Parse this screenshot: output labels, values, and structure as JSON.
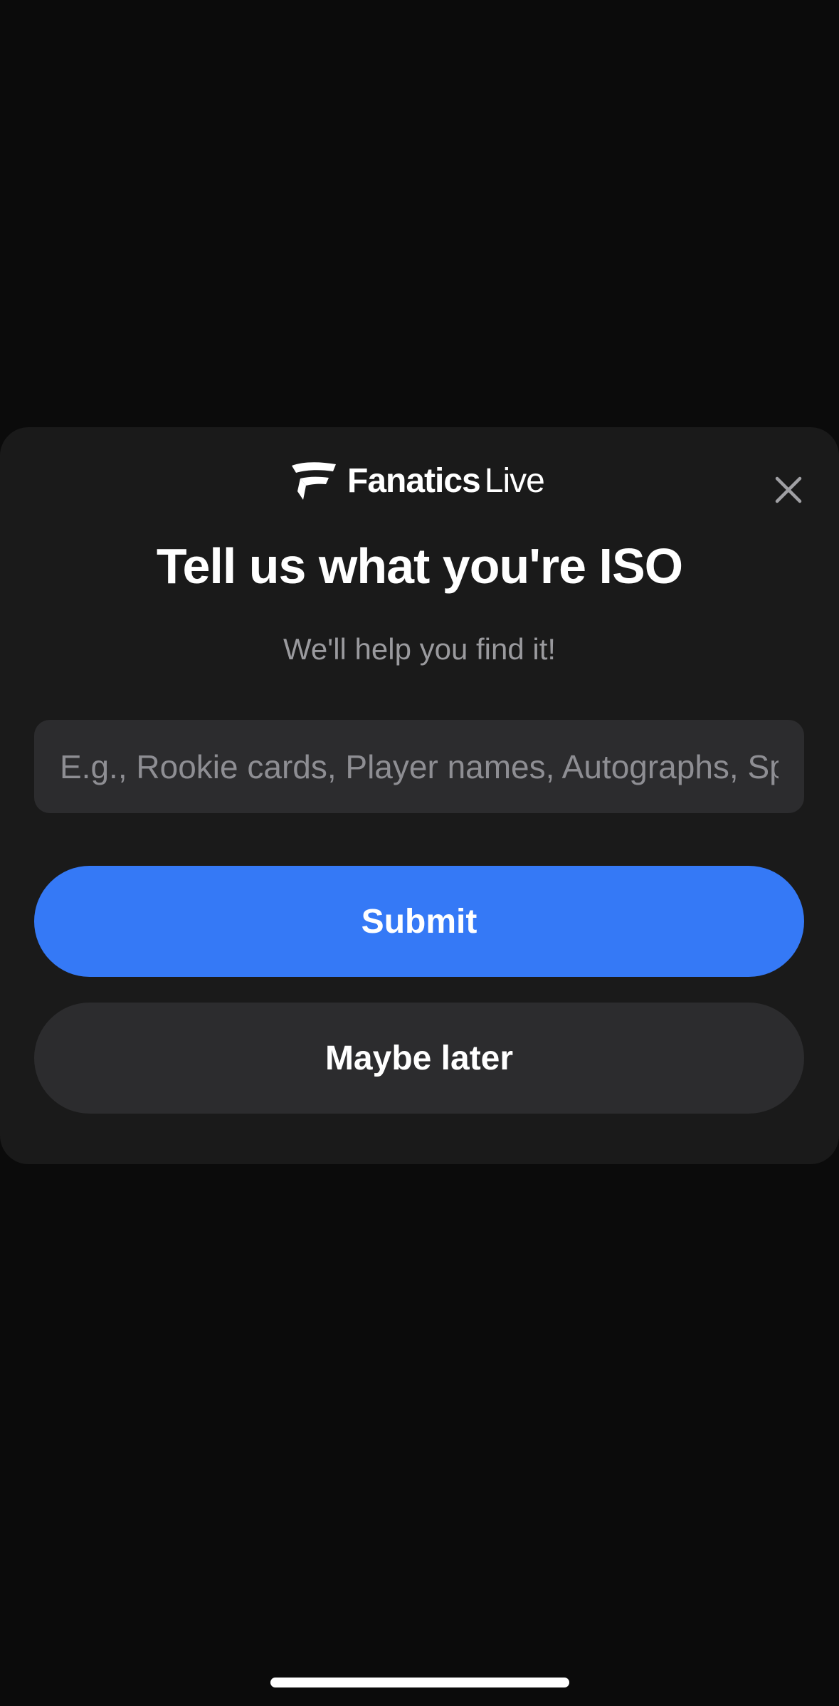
{
  "brand": {
    "name_bold": "Fanatics",
    "name_light": "Live",
    "icon": "fanatics-flag-logo-icon"
  },
  "modal": {
    "close_icon": "close-icon",
    "title": "Tell us what you're ISO",
    "subtitle": "We'll help you find it!",
    "search": {
      "value": "",
      "placeholder": "E.g., Rookie cards, Player names, Autographs, Sports"
    },
    "submit_label": "Submit",
    "later_label": "Maybe later"
  },
  "colors": {
    "background": "#0b0b0b",
    "modal_background": "#1a1a1a",
    "primary_button": "#3579f6",
    "secondary_button": "#2c2c2e",
    "subtitle_text": "#9a9a9e"
  }
}
